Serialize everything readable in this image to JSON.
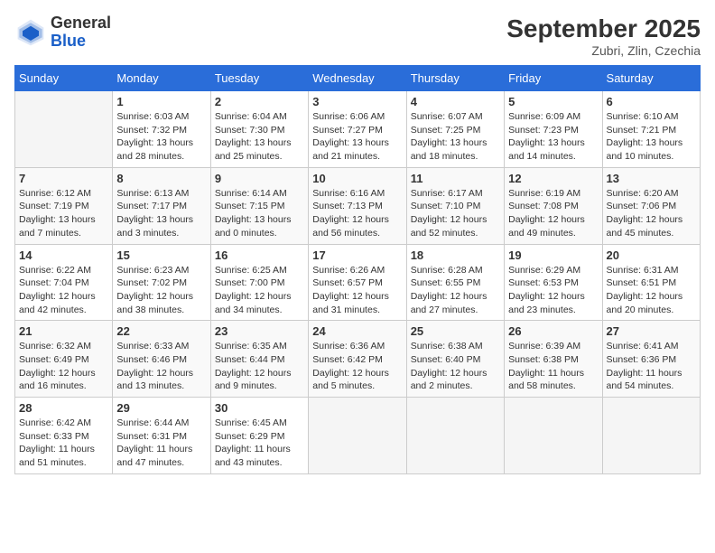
{
  "logo": {
    "general": "General",
    "blue": "Blue"
  },
  "title": "September 2025",
  "location": "Zubri, Zlin, Czechia",
  "weekdays": [
    "Sunday",
    "Monday",
    "Tuesday",
    "Wednesday",
    "Thursday",
    "Friday",
    "Saturday"
  ],
  "weeks": [
    [
      {
        "day": "",
        "info": ""
      },
      {
        "day": "1",
        "info": "Sunrise: 6:03 AM\nSunset: 7:32 PM\nDaylight: 13 hours\nand 28 minutes."
      },
      {
        "day": "2",
        "info": "Sunrise: 6:04 AM\nSunset: 7:30 PM\nDaylight: 13 hours\nand 25 minutes."
      },
      {
        "day": "3",
        "info": "Sunrise: 6:06 AM\nSunset: 7:27 PM\nDaylight: 13 hours\nand 21 minutes."
      },
      {
        "day": "4",
        "info": "Sunrise: 6:07 AM\nSunset: 7:25 PM\nDaylight: 13 hours\nand 18 minutes."
      },
      {
        "day": "5",
        "info": "Sunrise: 6:09 AM\nSunset: 7:23 PM\nDaylight: 13 hours\nand 14 minutes."
      },
      {
        "day": "6",
        "info": "Sunrise: 6:10 AM\nSunset: 7:21 PM\nDaylight: 13 hours\nand 10 minutes."
      }
    ],
    [
      {
        "day": "7",
        "info": "Sunrise: 6:12 AM\nSunset: 7:19 PM\nDaylight: 13 hours\nand 7 minutes."
      },
      {
        "day": "8",
        "info": "Sunrise: 6:13 AM\nSunset: 7:17 PM\nDaylight: 13 hours\nand 3 minutes."
      },
      {
        "day": "9",
        "info": "Sunrise: 6:14 AM\nSunset: 7:15 PM\nDaylight: 13 hours\nand 0 minutes."
      },
      {
        "day": "10",
        "info": "Sunrise: 6:16 AM\nSunset: 7:13 PM\nDaylight: 12 hours\nand 56 minutes."
      },
      {
        "day": "11",
        "info": "Sunrise: 6:17 AM\nSunset: 7:10 PM\nDaylight: 12 hours\nand 52 minutes."
      },
      {
        "day": "12",
        "info": "Sunrise: 6:19 AM\nSunset: 7:08 PM\nDaylight: 12 hours\nand 49 minutes."
      },
      {
        "day": "13",
        "info": "Sunrise: 6:20 AM\nSunset: 7:06 PM\nDaylight: 12 hours\nand 45 minutes."
      }
    ],
    [
      {
        "day": "14",
        "info": "Sunrise: 6:22 AM\nSunset: 7:04 PM\nDaylight: 12 hours\nand 42 minutes."
      },
      {
        "day": "15",
        "info": "Sunrise: 6:23 AM\nSunset: 7:02 PM\nDaylight: 12 hours\nand 38 minutes."
      },
      {
        "day": "16",
        "info": "Sunrise: 6:25 AM\nSunset: 7:00 PM\nDaylight: 12 hours\nand 34 minutes."
      },
      {
        "day": "17",
        "info": "Sunrise: 6:26 AM\nSunset: 6:57 PM\nDaylight: 12 hours\nand 31 minutes."
      },
      {
        "day": "18",
        "info": "Sunrise: 6:28 AM\nSunset: 6:55 PM\nDaylight: 12 hours\nand 27 minutes."
      },
      {
        "day": "19",
        "info": "Sunrise: 6:29 AM\nSunset: 6:53 PM\nDaylight: 12 hours\nand 23 minutes."
      },
      {
        "day": "20",
        "info": "Sunrise: 6:31 AM\nSunset: 6:51 PM\nDaylight: 12 hours\nand 20 minutes."
      }
    ],
    [
      {
        "day": "21",
        "info": "Sunrise: 6:32 AM\nSunset: 6:49 PM\nDaylight: 12 hours\nand 16 minutes."
      },
      {
        "day": "22",
        "info": "Sunrise: 6:33 AM\nSunset: 6:46 PM\nDaylight: 12 hours\nand 13 minutes."
      },
      {
        "day": "23",
        "info": "Sunrise: 6:35 AM\nSunset: 6:44 PM\nDaylight: 12 hours\nand 9 minutes."
      },
      {
        "day": "24",
        "info": "Sunrise: 6:36 AM\nSunset: 6:42 PM\nDaylight: 12 hours\nand 5 minutes."
      },
      {
        "day": "25",
        "info": "Sunrise: 6:38 AM\nSunset: 6:40 PM\nDaylight: 12 hours\nand 2 minutes."
      },
      {
        "day": "26",
        "info": "Sunrise: 6:39 AM\nSunset: 6:38 PM\nDaylight: 11 hours\nand 58 minutes."
      },
      {
        "day": "27",
        "info": "Sunrise: 6:41 AM\nSunset: 6:36 PM\nDaylight: 11 hours\nand 54 minutes."
      }
    ],
    [
      {
        "day": "28",
        "info": "Sunrise: 6:42 AM\nSunset: 6:33 PM\nDaylight: 11 hours\nand 51 minutes."
      },
      {
        "day": "29",
        "info": "Sunrise: 6:44 AM\nSunset: 6:31 PM\nDaylight: 11 hours\nand 47 minutes."
      },
      {
        "day": "30",
        "info": "Sunrise: 6:45 AM\nSunset: 6:29 PM\nDaylight: 11 hours\nand 43 minutes."
      },
      {
        "day": "",
        "info": ""
      },
      {
        "day": "",
        "info": ""
      },
      {
        "day": "",
        "info": ""
      },
      {
        "day": "",
        "info": ""
      }
    ]
  ]
}
